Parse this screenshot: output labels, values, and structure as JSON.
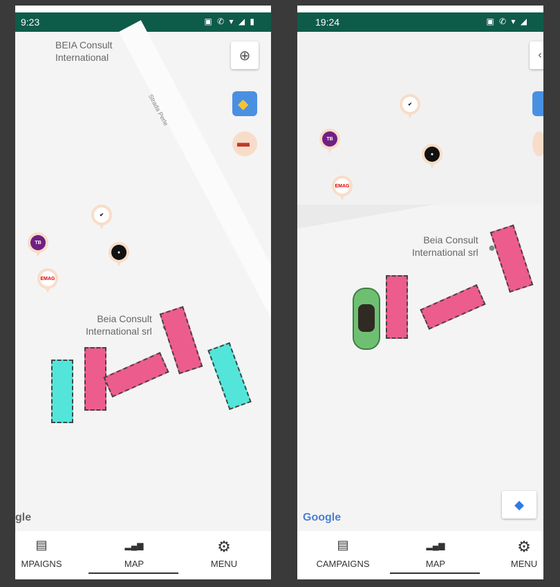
{
  "left": {
    "status": {
      "time": "9:23",
      "icons": "▣ ✆ ▾ ◢ ▮"
    },
    "poi": {
      "line1": "BEIA Consult",
      "line2": "International"
    },
    "street": "Strada Perle",
    "place": {
      "line1": "Beia Consult",
      "line2": "International srl"
    },
    "google": "gle",
    "nav": {
      "campaigns": "MPAIGNS",
      "map": "MAP",
      "menu": "MENU"
    },
    "pins": {
      "nike": "✔",
      "emag": "EMAG",
      "tacobell": "TB",
      "dark": "●"
    }
  },
  "right": {
    "status": {
      "time": "19:24",
      "icons": "▣ ✆ ▾ ◢"
    },
    "place": {
      "line1": "Beia Consult",
      "line2": "International srl"
    },
    "google": "Google",
    "nav": {
      "campaigns": "CAMPAIGNS",
      "map": "MAP",
      "menu": "MENU"
    },
    "pins": {
      "nike": "✔",
      "emag": "EMAG",
      "tacobell": "TB",
      "dark": "●"
    }
  },
  "colors": {
    "status_bar": "#0f5b4a",
    "zone_pink": "#ec5c8c",
    "zone_cyan": "#53e5d9",
    "car": "#6fbf73"
  }
}
